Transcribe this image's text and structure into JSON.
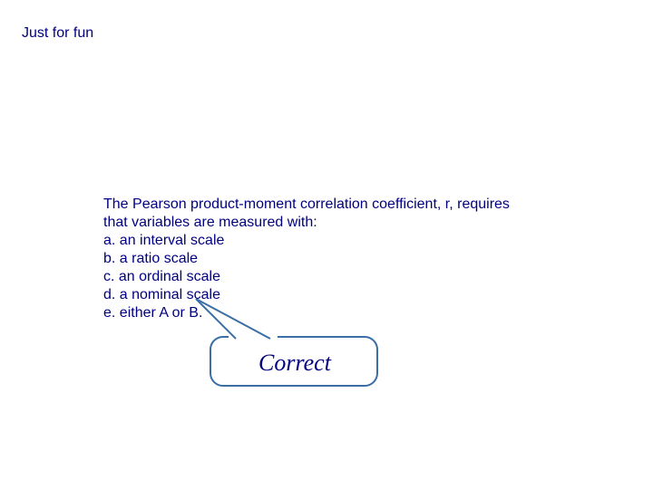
{
  "header": {
    "title": "Just for fun"
  },
  "question": {
    "stem_line1": "The Pearson product-moment correlation coefficient, r, requires",
    "stem_line2": "that variables are measured with:",
    "options": {
      "a": "a. an interval scale",
      "b": "b. a ratio scale",
      "c": "c. an ordinal scale",
      "d": "d. a nominal scale",
      "e": "e. either A or B."
    }
  },
  "callout": {
    "label": "Correct",
    "points_to": "e"
  },
  "colors": {
    "text": "#000080",
    "callout_border": "#3a6ea5",
    "callout_fill": "#ffffff"
  }
}
